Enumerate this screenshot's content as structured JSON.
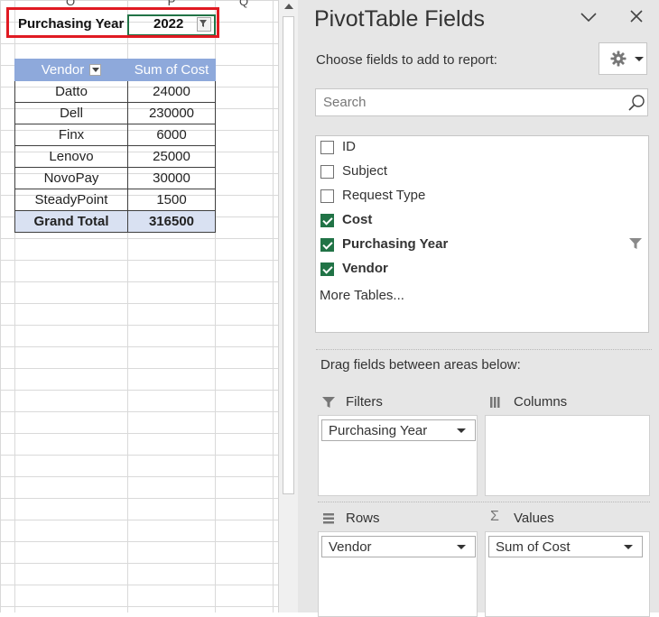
{
  "sheet": {
    "col_headers": [
      "O",
      "P",
      "Q"
    ],
    "page_filter": {
      "label": "Purchasing Year",
      "value": "2022"
    },
    "pivot": {
      "headers": [
        "Vendor",
        "Sum of Cost"
      ],
      "rows": [
        {
          "vendor": "Datto",
          "cost": "24000"
        },
        {
          "vendor": "Dell",
          "cost": "230000"
        },
        {
          "vendor": "Finx",
          "cost": "6000"
        },
        {
          "vendor": "Lenovo",
          "cost": "25000"
        },
        {
          "vendor": "NovoPay",
          "cost": "30000"
        },
        {
          "vendor": "SteadyPoint",
          "cost": "1500"
        }
      ],
      "total": {
        "label": "Grand Total",
        "value": "316500"
      }
    },
    "highlight_color": "#e01a22"
  },
  "pane": {
    "title": "PivotTable Fields",
    "choose_label": "Choose fields to add to report:",
    "search_placeholder": "Search",
    "fields": [
      {
        "label": "ID",
        "checked": false
      },
      {
        "label": "Subject",
        "checked": false
      },
      {
        "label": "Request Type",
        "checked": false
      },
      {
        "label": "Cost",
        "checked": true
      },
      {
        "label": "Purchasing Year",
        "checked": true,
        "filtered": true
      },
      {
        "label": "Vendor",
        "checked": true
      }
    ],
    "more_tables": "More Tables...",
    "drag_label": "Drag fields between areas below:",
    "areas": {
      "filters": {
        "title": "Filters",
        "icon": "filter-icon",
        "items": [
          "Purchasing Year"
        ]
      },
      "columns": {
        "title": "Columns",
        "icon": "columns-icon",
        "items": []
      },
      "rows": {
        "title": "Rows",
        "icon": "rows-icon",
        "items": [
          "Vendor"
        ]
      },
      "values": {
        "title": "Values",
        "icon": "sigma-icon",
        "items": [
          "Sum of Cost"
        ]
      }
    },
    "accent_color": "#217346"
  }
}
